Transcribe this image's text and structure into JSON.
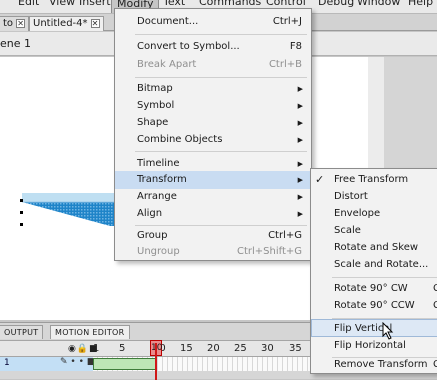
{
  "menubar": {
    "items": [
      "Edit",
      "View",
      "Insert",
      "Modify",
      "Text",
      "Commands",
      "Control",
      "Debug",
      "Window",
      "Help"
    ]
  },
  "tabs": {
    "first": "to",
    "second": "Untitled-4*"
  },
  "editbar": {
    "scene": "ene 1"
  },
  "modify_menu": {
    "items": [
      {
        "label": "Document...",
        "shortcut": "Ctrl+J"
      },
      {
        "label": "Convert to Symbol...",
        "shortcut": "F8"
      },
      {
        "label": "Break Apart",
        "shortcut": "Ctrl+B"
      },
      {
        "label": "Bitmap"
      },
      {
        "label": "Symbol"
      },
      {
        "label": "Shape"
      },
      {
        "label": "Combine Objects"
      },
      {
        "label": "Timeline"
      },
      {
        "label": "Transform"
      },
      {
        "label": "Arrange"
      },
      {
        "label": "Align"
      },
      {
        "label": "Group",
        "shortcut": "Ctrl+G"
      },
      {
        "label": "Ungroup",
        "shortcut": "Ctrl+Shift+G"
      }
    ]
  },
  "transform_menu": {
    "items": [
      {
        "label": "Free Transform"
      },
      {
        "label": "Distort"
      },
      {
        "label": "Envelope"
      },
      {
        "label": "Scale"
      },
      {
        "label": "Rotate and Skew"
      },
      {
        "label": "Scale and Rotate..."
      },
      {
        "label": "Rotate 90° CW",
        "shortcut_partial": "C"
      },
      {
        "label": "Rotate 90° CCW",
        "shortcut_partial": "C"
      },
      {
        "label": "Flip Vertical"
      },
      {
        "label": "Flip Horizontal"
      },
      {
        "label": "Remove Transform",
        "shortcut_partial": "C"
      }
    ]
  },
  "timeline": {
    "tabs": [
      "OUTPUT",
      "MOTION EDITOR"
    ],
    "frame_numbers": [
      "1",
      "5",
      "10",
      "15",
      "20",
      "25",
      "30",
      "35"
    ],
    "layer_number": "1",
    "current_frame": "10"
  },
  "colors": {
    "menu_highlight": "#c9dcf2",
    "layer_row": "#c3dff5",
    "tween_span": "#bde6b6",
    "playhead": "#d01818",
    "shape_blue": "#1f84c8"
  }
}
